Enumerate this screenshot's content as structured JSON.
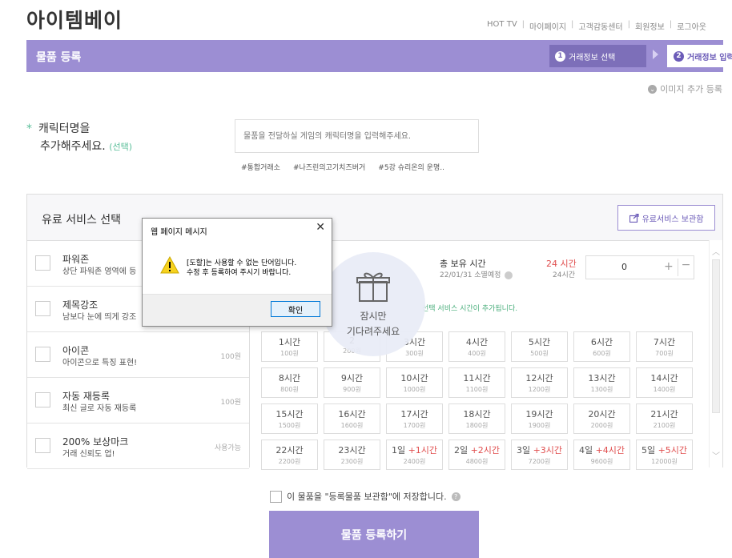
{
  "header": {
    "logo": "아이템베이",
    "nav": [
      "HOT TV",
      "마이페이지",
      "고객감동센터",
      "회원정보",
      "로그아웃"
    ]
  },
  "title_bar": {
    "title": "물품 등록",
    "step1": {
      "num": "1",
      "label": "거래정보 선택"
    },
    "step2": {
      "num": "2",
      "label": "거래정보 입력"
    }
  },
  "image_add": "이미지 추가 등록",
  "character": {
    "label_line1": "캐릭터명을",
    "label_line2": "추가해주세요.",
    "optional": "(선택)",
    "placeholder": "물품을 전달하실 게임의 캐릭터명을 입력해주세요.",
    "tags": [
      "#통합거래소",
      "#나즈린의고기치즈버거",
      "#5강 슈리온의 운명.."
    ]
  },
  "paid": {
    "title": "유료 서비스 선택",
    "storage_button": "유료서비스 보관함",
    "services": [
      {
        "name": "파워존",
        "desc": "상단 파워존 영역에 등",
        "price": ""
      },
      {
        "name": "제목강조",
        "desc": "남보다 눈에 띄게 강조",
        "price": ""
      },
      {
        "name": "아이콘",
        "desc": "아이콘으로 특징 표현!",
        "price": "100원"
      },
      {
        "name": "자동 재등록",
        "desc": "최신 글로 자동 재등록",
        "price": "100원"
      },
      {
        "name": "200% 보상마크",
        "desc": "거래 신뢰도 업!",
        "price": "사용가능"
      }
    ],
    "owned_label": "총 보유 시간",
    "owned_sub": "22/01/31 소멸예정",
    "hours_red": "24 시간",
    "hours_sub": "24시간",
    "qty": "0",
    "plus": "+",
    "minus": "−",
    "notice": "선택 서비스 시간이 추가됩니다.",
    "cells": [
      {
        "h": "1시간",
        "x": "",
        "p": "100원"
      },
      {
        "h": "2",
        "x": "",
        "p": "200원"
      },
      {
        "h": "3시간",
        "x": "",
        "p": "300원"
      },
      {
        "h": "4시간",
        "x": "",
        "p": "400원"
      },
      {
        "h": "5시간",
        "x": "",
        "p": "500원"
      },
      {
        "h": "6시간",
        "x": "",
        "p": "600원"
      },
      {
        "h": "7시간",
        "x": "",
        "p": "700원"
      },
      {
        "h": "8시간",
        "x": "",
        "p": "800원"
      },
      {
        "h": "9시간",
        "x": "",
        "p": "900원"
      },
      {
        "h": "10시간",
        "x": "",
        "p": "1000원"
      },
      {
        "h": "11시간",
        "x": "",
        "p": "1100원"
      },
      {
        "h": "12시간",
        "x": "",
        "p": "1200원"
      },
      {
        "h": "13시간",
        "x": "",
        "p": "1300원"
      },
      {
        "h": "14시간",
        "x": "",
        "p": "1400원"
      },
      {
        "h": "15시간",
        "x": "",
        "p": "1500원"
      },
      {
        "h": "16시간",
        "x": "",
        "p": "1600원"
      },
      {
        "h": "17시간",
        "x": "",
        "p": "1700원"
      },
      {
        "h": "18시간",
        "x": "",
        "p": "1800원"
      },
      {
        "h": "19시간",
        "x": "",
        "p": "1900원"
      },
      {
        "h": "20시간",
        "x": "",
        "p": "2000원"
      },
      {
        "h": "21시간",
        "x": "",
        "p": "2100원"
      },
      {
        "h": "22시간",
        "x": "",
        "p": "2200원"
      },
      {
        "h": "23시간",
        "x": "",
        "p": "2300원"
      },
      {
        "h": "1일 ",
        "x": "+1시간",
        "p": "2400원"
      },
      {
        "h": "2일 ",
        "x": "+2시간",
        "p": "4800원"
      },
      {
        "h": "3일 ",
        "x": "+3시간",
        "p": "7200원"
      },
      {
        "h": "4일 ",
        "x": "+4시간",
        "p": "9600원"
      },
      {
        "h": "5일 ",
        "x": "+5시간",
        "p": "12000원"
      }
    ]
  },
  "loading": {
    "line1": "잠시만",
    "line2": "기다려주세요"
  },
  "save_label": "이 물품을 \"등록물품 보관함\"에 저장합니다.",
  "submit_label": "물품 등록하기",
  "dialog": {
    "title": "웹 페이지 메시지",
    "close": "✕",
    "line1": "[도할]는 사용할 수 없는 단어입니다.",
    "line2": "수정 후 등록하여 주시기 바랍니다.",
    "ok": "확인"
  }
}
